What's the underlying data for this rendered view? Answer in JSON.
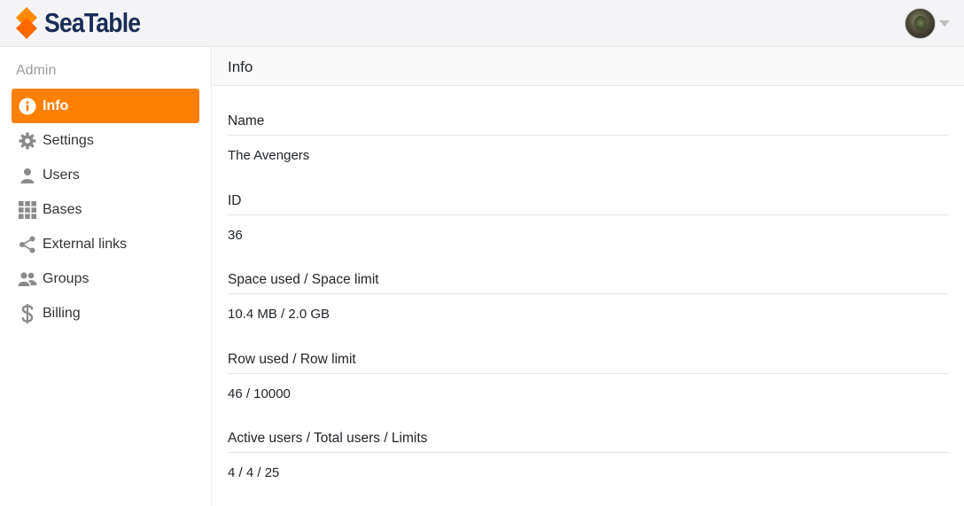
{
  "app": {
    "brand": "SeaTable",
    "brand_color": "#ff8000",
    "brand_text_color": "#1a2c56"
  },
  "topbar": {
    "avatar_icon": "user-avatar",
    "menu_icon": "caret-down-icon"
  },
  "sidebar": {
    "title": "Admin",
    "items": [
      {
        "label": "Info",
        "icon": "info-icon",
        "active": true
      },
      {
        "label": "Settings",
        "icon": "gear-icon",
        "active": false
      },
      {
        "label": "Users",
        "icon": "user-icon",
        "active": false
      },
      {
        "label": "Bases",
        "icon": "grid-icon",
        "active": false
      },
      {
        "label": "External links",
        "icon": "share-icon",
        "active": false
      },
      {
        "label": "Groups",
        "icon": "group-icon",
        "active": false
      },
      {
        "label": "Billing",
        "icon": "dollar-icon",
        "active": false
      }
    ]
  },
  "main": {
    "title": "Info",
    "fields": [
      {
        "label": "Name",
        "value": "The Avengers"
      },
      {
        "label": "ID",
        "value": "36"
      },
      {
        "label": "Space used / Space limit",
        "value": "10.4 MB / 2.0 GB"
      },
      {
        "label": "Row used / Row limit",
        "value": "46 / 10000"
      },
      {
        "label": "Active users / Total users / Limits",
        "value": "4 / 4 / 25"
      }
    ]
  }
}
